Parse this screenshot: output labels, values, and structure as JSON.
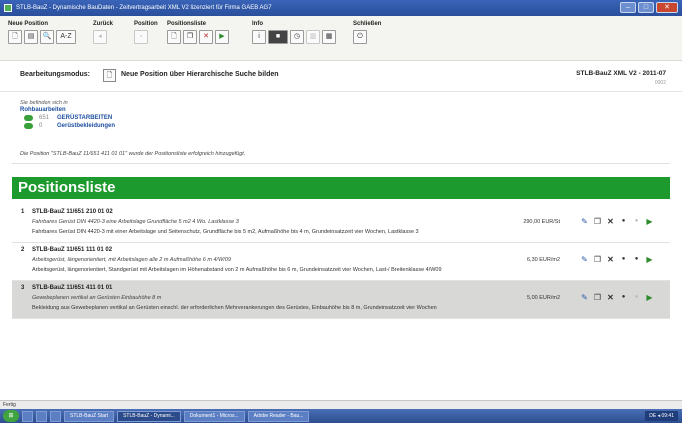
{
  "window": {
    "title": "STLB-BauZ - Dynamische BauDaten - Zeitvertragsarbeit XML V2 lizenziert für Firma GAEB AG7",
    "controls": [
      "–",
      "□",
      "✕"
    ]
  },
  "toolbar": {
    "groups": [
      {
        "label": "Neue Position",
        "buttons": [
          {
            "name": "new-position-button",
            "icon": "document-icon",
            "glyph": "🗋",
            "style": ""
          },
          {
            "name": "new-position-folder-button",
            "icon": "folder-icon",
            "glyph": "▤",
            "style": ""
          },
          {
            "name": "new-position-search-button",
            "icon": "search-document-icon",
            "glyph": "🔍",
            "style": ""
          },
          {
            "name": "new-position-az-button",
            "icon": "az-icon",
            "glyph": "A-Z",
            "style": "wide"
          }
        ]
      },
      {
        "label": "Zurück",
        "buttons": [
          {
            "name": "back-button",
            "icon": "back-icon",
            "glyph": "◂",
            "style": "dim"
          }
        ]
      },
      {
        "label": "Position",
        "buttons": [
          {
            "name": "position-button",
            "icon": "position-icon",
            "glyph": "▫",
            "style": "dim"
          }
        ]
      },
      {
        "label": "Positionsliste",
        "buttons": [
          {
            "name": "list-new-button",
            "icon": "document-icon",
            "glyph": "🗋",
            "style": ""
          },
          {
            "name": "list-copy-button",
            "icon": "copy-icon",
            "glyph": "❐",
            "style": ""
          },
          {
            "name": "list-delete-button",
            "icon": "delete-icon",
            "glyph": "✕",
            "style": "red"
          },
          {
            "name": "list-export-button",
            "icon": "export-icon",
            "glyph": "▶",
            "style": "green"
          }
        ]
      },
      {
        "label": "Info",
        "buttons": [
          {
            "name": "info-button",
            "icon": "info-icon",
            "glyph": "i",
            "style": ""
          },
          {
            "name": "info-dark-button",
            "icon": "monitor-icon",
            "glyph": "■",
            "style": "dark"
          },
          {
            "name": "info-clock-button",
            "icon": "clock-icon",
            "glyph": "◷",
            "style": ""
          },
          {
            "name": "info-chart-button",
            "icon": "chart-icon",
            "glyph": "▥",
            "style": "dim"
          },
          {
            "name": "info-calendar-button",
            "icon": "calendar-icon",
            "glyph": "▦",
            "style": ""
          }
        ]
      },
      {
        "label": "Schließen",
        "buttons": [
          {
            "name": "close-app-button",
            "icon": "power-icon",
            "glyph": "⏻",
            "style": ""
          }
        ]
      }
    ]
  },
  "mode": {
    "label": "Bearbeitungsmodus:",
    "value": "Neue Position über Hierarchische Suche bilden",
    "version": "STLB-BauZ XML V2 - 2011-07",
    "version_sub": "0002"
  },
  "breadcrumb": {
    "intro": "Sie befinden sich in",
    "root": "Rohbauarbeiten",
    "items": [
      {
        "num": "651",
        "title": "GERÜSTARBEITEN"
      },
      {
        "num": "0",
        "title": "Gerüstbekleidungen"
      }
    ]
  },
  "message": "Die Position \"STLB-BauZ 11/651 411 01 01\" wurde der Positionsliste erfolgreich hinzugefügt.",
  "positions_title": "Positionsliste",
  "positions": [
    {
      "idx": "1",
      "code": "STLB-BauZ 11/651 210 01 02",
      "short": "Fahrbares Gerüst DIN 4420-3 eine Arbeitslage Grundfläche 5 m2 4 Wo. Lastklasse 3",
      "long": "Fahrbares Gerüst DIN 4420-3 mit einer Arbeitslage und Seitenschutz, Grundfläche bis 5 m2, Aufmaßhöhe bis 4 m, Grundeinsatzzeit vier Wochen, Lastklasse 3",
      "price": "290,00 EUR/St",
      "shaded": false
    },
    {
      "idx": "2",
      "code": "STLB-BauZ 11/651 111 01 02",
      "short": "Arbeitsgerüst, längenorientiert, mit Arbeitslagen alle 2 m Aufmaßhöhe 6 m 4/W/09",
      "long": "Arbeitsgerüst, längenorientiert, Standgerüst mit Arbeitslagen im Höhenabstand von 2 m Aufmaßhöhe bis 6 m, Grundeinsatzzeit vier Wochen, Last-/ Breitenklasse 4/W09",
      "price": "6,30 EUR/m2",
      "shaded": false
    },
    {
      "idx": "3",
      "code": "STLB-BauZ 11/651 411 01 01",
      "short": "Gewebeplanen vertikal an Gerüsten Einbauhöhe 8 m",
      "long": "Bekleidung aus Gewebeplanen vertikal an Gerüsten einschl. der erforderlichen Mehrverankerungen des Gerüstes, Einbauhöhe bis 8 m, Grundeinsatzzeit vier Wochen",
      "price": "5,00 EUR/m2",
      "shaded": true
    }
  ],
  "statusbar": "Fertig",
  "taskbar": {
    "start": "⊞",
    "items": [
      {
        "label": "",
        "quick": true
      },
      {
        "label": "",
        "quick": true
      },
      {
        "label": "",
        "quick": true
      },
      {
        "label": "STLB-BauZ Start",
        "active": false
      },
      {
        "label": "STLB-BauZ - Dynami...",
        "active": true
      },
      {
        "label": "Dokument1 - Micros...",
        "active": false
      },
      {
        "label": "Adobe Reader - Bau...",
        "active": false
      }
    ],
    "tray": "DE ◂ 09:41"
  }
}
